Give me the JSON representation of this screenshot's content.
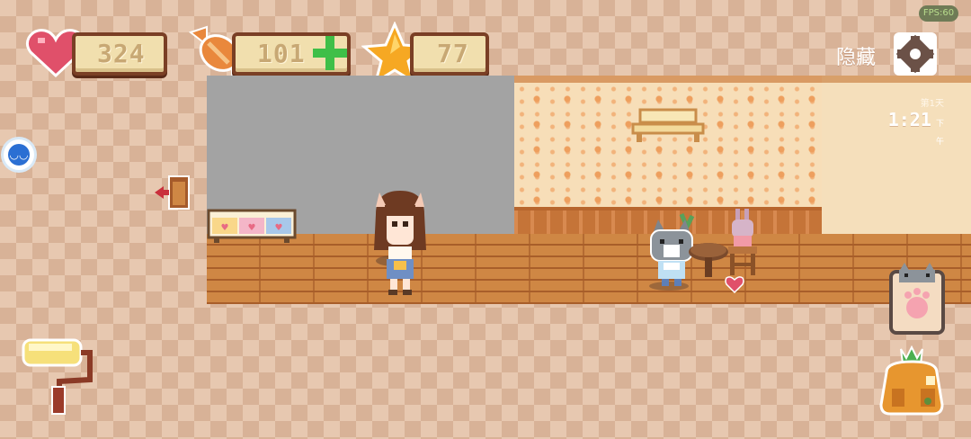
{
  "hud": {
    "hearts": "324",
    "candy": "101",
    "stars": "77",
    "fps_badge": "FPS:60",
    "hide_label": "隐藏"
  },
  "clock": {
    "day": "第1天",
    "time": "1:21",
    "ampm": "下午"
  },
  "colors": {
    "heart": "#e0506a",
    "candy": "#e9883c",
    "star": "#f6a823",
    "plus": "#3fbf48",
    "bar_border": "#7a3f25"
  }
}
